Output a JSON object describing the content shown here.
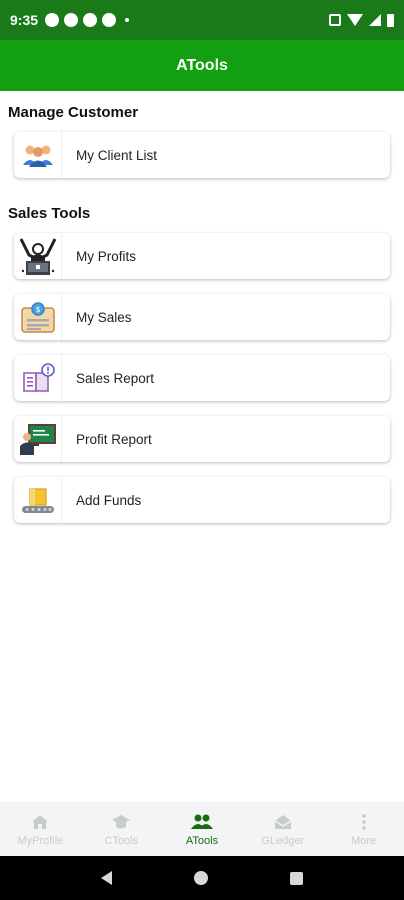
{
  "status_bar": {
    "time": "9:35"
  },
  "app_bar": {
    "title": "ATools"
  },
  "sections": {
    "manage_customer": "Manage Customer",
    "sales_tools": "Sales Tools"
  },
  "menu": {
    "client_list": "My Client List",
    "profits": "My Profits",
    "sales": "My Sales",
    "sales_report": "Sales Report",
    "profit_report": "Profit Report",
    "add_funds": "Add Funds"
  },
  "bottom_nav": {
    "myprofile": "MyProfile",
    "ctools": "CTools",
    "atools": "ATools",
    "gledger": "GLedger",
    "more": "More"
  },
  "colors": {
    "status_bar": "#1a7a1a",
    "app_bar": "#12a012",
    "nav_active": "#136d13",
    "nav_inactive": "#c6cdc6"
  }
}
